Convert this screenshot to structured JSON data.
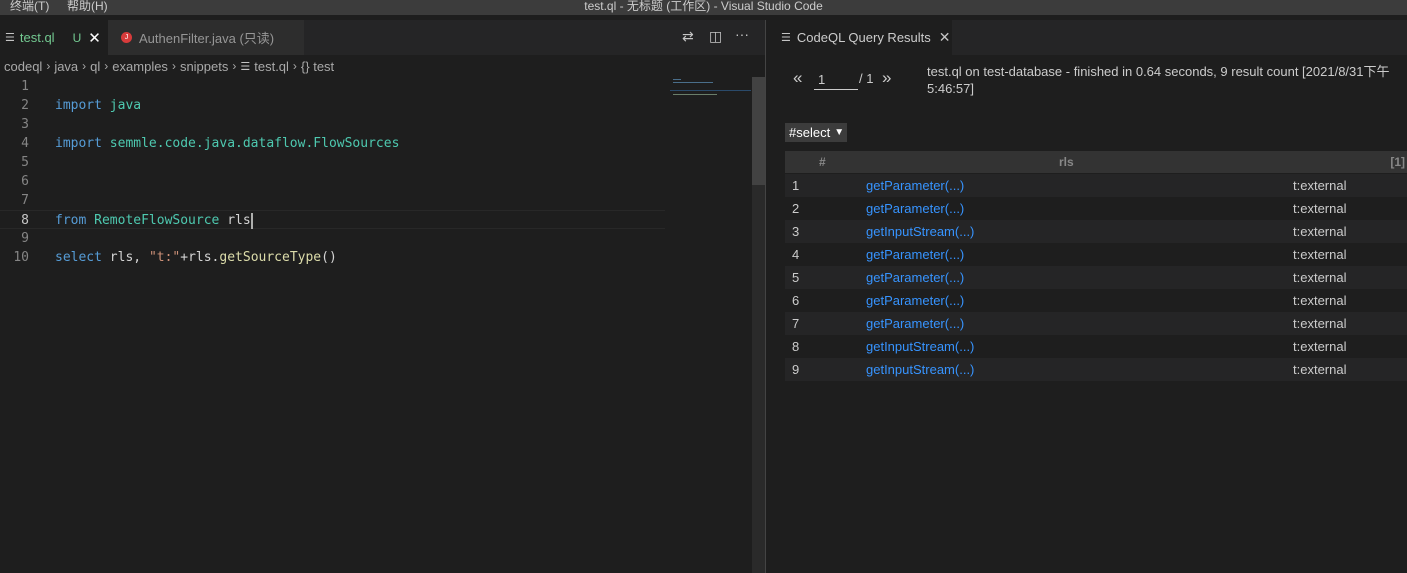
{
  "window": {
    "title": "test.ql - 无标题 (工作区) - Visual Studio Code",
    "menus": [
      "终端(T)",
      "帮助(H)"
    ]
  },
  "editor_tabs": [
    {
      "label": "test.ql",
      "status": "U",
      "icon": "ql-file-icon",
      "active": true
    },
    {
      "label": "AuthenFilter.java (只读)",
      "icon": "java-file-icon",
      "active": false
    }
  ],
  "editor_actions": {
    "compare": "⇄",
    "split": "◫",
    "more": "···"
  },
  "breadcrumb": [
    "codeql",
    "java",
    "ql",
    "examples",
    "snippets",
    "test.ql",
    "{} test"
  ],
  "code_lines": [
    {
      "n": "1",
      "tokens": []
    },
    {
      "n": "2",
      "tokens": [
        {
          "t": "import",
          "c": "kw"
        },
        {
          "t": " ",
          "c": "plain"
        },
        {
          "t": "java",
          "c": "mod-id"
        }
      ]
    },
    {
      "n": "3",
      "tokens": []
    },
    {
      "n": "4",
      "tokens": [
        {
          "t": "import",
          "c": "kw"
        },
        {
          "t": " semmle.code.java.dataflow.",
          "c": "mod-id"
        },
        {
          "t": "FlowSources",
          "c": "mod-id"
        }
      ]
    },
    {
      "n": "5",
      "tokens": []
    },
    {
      "n": "6",
      "tokens": []
    },
    {
      "n": "7",
      "tokens": []
    },
    {
      "n": "8",
      "tokens": [
        {
          "t": "from",
          "c": "kw"
        },
        {
          "t": " ",
          "c": "plain"
        },
        {
          "t": "RemoteFlowSource",
          "c": "mod-id"
        },
        {
          "t": " rls",
          "c": "plain"
        }
      ],
      "current": true
    },
    {
      "n": "9",
      "tokens": []
    },
    {
      "n": "10",
      "tokens": [
        {
          "t": "select",
          "c": "kw"
        },
        {
          "t": " rls, ",
          "c": "plain"
        },
        {
          "t": "\"t:\"",
          "c": "str"
        },
        {
          "t": "+rls.",
          "c": "plain"
        },
        {
          "t": "getSourceType",
          "c": "fn"
        },
        {
          "t": "()",
          "c": "plain"
        }
      ]
    }
  ],
  "results_panel": {
    "tab_label": "CodeQL Query Results",
    "page_current": "1",
    "page_total": "/ 1",
    "prev_label": "«",
    "next_label": "»",
    "summary": "test.ql on test-database - finished in 0.64 seconds, 9 result count [2021/8/31下午5:46:57]",
    "result_set": "#select",
    "columns": [
      "#",
      "rls",
      "[1]"
    ],
    "rows": [
      {
        "num": "1",
        "rls": "getParameter(...)",
        "col1": "t:external"
      },
      {
        "num": "2",
        "rls": "getParameter(...)",
        "col1": "t:external"
      },
      {
        "num": "3",
        "rls": "getInputStream(...)",
        "col1": "t:external"
      },
      {
        "num": "4",
        "rls": "getParameter(...)",
        "col1": "t:external"
      },
      {
        "num": "5",
        "rls": "getParameter(...)",
        "col1": "t:external"
      },
      {
        "num": "6",
        "rls": "getParameter(...)",
        "col1": "t:external"
      },
      {
        "num": "7",
        "rls": "getParameter(...)",
        "col1": "t:external"
      },
      {
        "num": "8",
        "rls": "getInputStream(...)",
        "col1": "t:external"
      },
      {
        "num": "9",
        "rls": "getInputStream(...)",
        "col1": "t:external"
      }
    ]
  },
  "colors": {
    "keyword": "#569cd6",
    "type": "#4ec9b0",
    "string": "#ce9178",
    "function": "#dcdcaa",
    "link": "#3794ff",
    "untracked": "#73c991",
    "java_icon": "#d83b3b"
  }
}
